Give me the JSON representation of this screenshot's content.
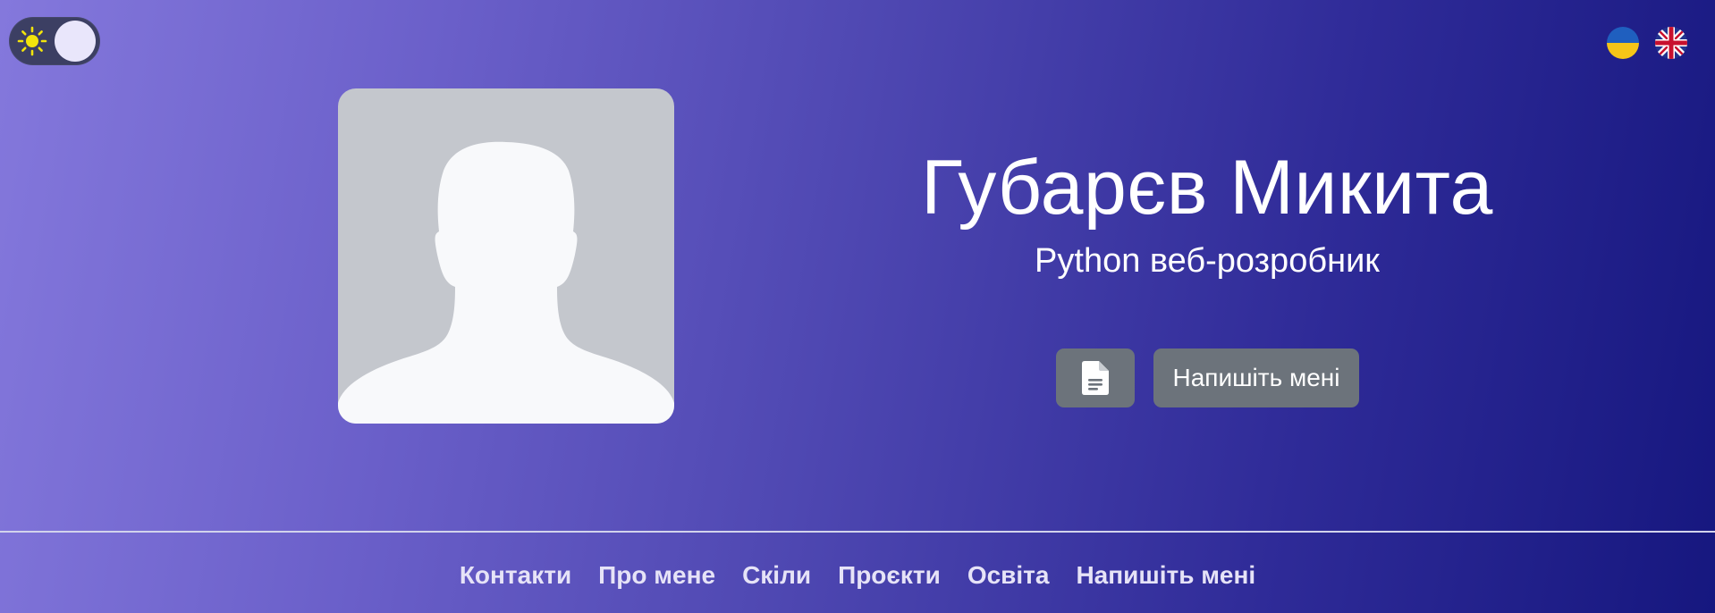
{
  "header": {
    "theme_toggle": {
      "state": "light",
      "icon": "sun-icon"
    },
    "languages": [
      {
        "code": "uk",
        "icon": "flag-ukraine-icon"
      },
      {
        "code": "en",
        "icon": "flag-uk-icon"
      }
    ]
  },
  "hero": {
    "name": "Губарєв Микита",
    "subtitle": "Python веб-розробник",
    "avatar_icon": "user-silhouette-icon",
    "cv_button_icon": "document-icon",
    "contact_button_label": "Напишіть мені"
  },
  "nav": {
    "items": [
      {
        "label": "Контакти"
      },
      {
        "label": "Про мене"
      },
      {
        "label": "Скіли"
      },
      {
        "label": "Проєкти"
      },
      {
        "label": "Освіта"
      },
      {
        "label": "Напишіть мені"
      }
    ]
  },
  "colors": {
    "gradient_start": "#8478dc",
    "gradient_end": "#16177f",
    "button_bg": "#6c737b",
    "avatar_bg": "#c4c7cd",
    "nav_text": "#e6e3f7"
  }
}
